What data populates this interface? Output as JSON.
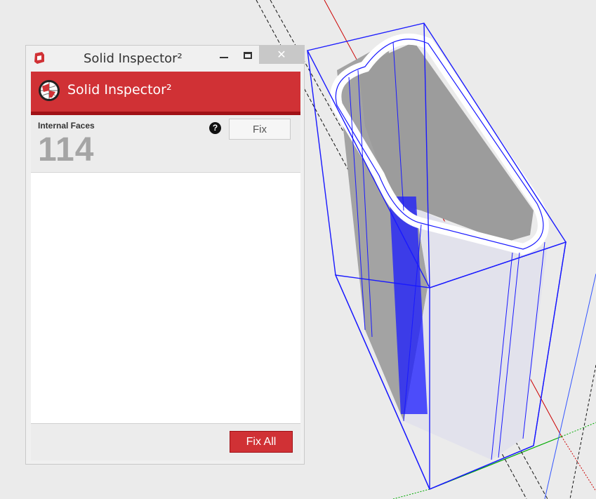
{
  "window": {
    "title": "Solid Inspector²",
    "close_glyph": "✕"
  },
  "header": {
    "title": "Solid Inspector²",
    "accent_color": "#d03135",
    "accent_dark": "#a01116"
  },
  "issue": {
    "label": "Internal Faces",
    "count": "114",
    "help_glyph": "?",
    "fix_label": "Fix"
  },
  "footer": {
    "fix_all_label": "Fix All"
  },
  "icons": {
    "app": "sketchup-logo-icon",
    "header": "globe-icon",
    "help": "help-icon"
  },
  "viewport": {
    "background": "#ebebeb",
    "selection_color": "#1a1aff",
    "axis_red": "#cc0000",
    "axis_green": "#00aa00"
  }
}
